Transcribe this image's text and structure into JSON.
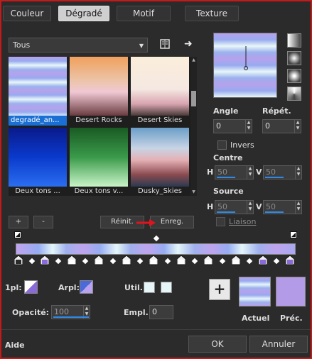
{
  "tabs": [
    {
      "label": "Couleur"
    },
    {
      "label": "Dégradé"
    },
    {
      "label": "Motif"
    },
    {
      "label": "Texture"
    }
  ],
  "category_dropdown": {
    "value": "Tous"
  },
  "presets": [
    {
      "label": "degradé_an...",
      "selected": true
    },
    {
      "label": "Desert Rocks"
    },
    {
      "label": "Desert Skies"
    },
    {
      "label": "Deux tons ..."
    },
    {
      "label": "Deux tons v..."
    },
    {
      "label": "Dusky_Skies"
    }
  ],
  "buttons": {
    "add": "+",
    "remove": "-",
    "reset": "Réinit.",
    "save": "Enreg.",
    "ok": "OK",
    "cancel": "Annuler",
    "add_color": "+"
  },
  "angle": {
    "label": "Angle",
    "value": "0"
  },
  "repeat": {
    "label": "Répét.",
    "value": "0"
  },
  "invert": {
    "label": "Invers",
    "checked": false
  },
  "center": {
    "label": "Centre",
    "h_label": "H",
    "h": "50",
    "v_label": "V",
    "v": "50"
  },
  "source": {
    "label": "Source",
    "h_label": "H",
    "h": "50",
    "v_label": "V",
    "v": "50"
  },
  "link": {
    "label": "Liaison",
    "checked": false
  },
  "stops": {
    "opacity_label": "1pl:",
    "midpoint_label": "Arpl:",
    "use_label": "Util.:",
    "opacity_field_label": "Opacité:",
    "opacity_value": "100",
    "location_label": "Empl.:",
    "location_value": "0"
  },
  "current_label": "Actuel",
  "previous_label": "Préc.",
  "help_label": "Aide",
  "colors": {
    "gradient_lavender": "#b9a3ee",
    "gradient_blue": "#8fa9ee",
    "gradient_light": "#e3f5f7",
    "previous_swatch": "#b39be8",
    "selection_blue": "#1a6fd4"
  }
}
